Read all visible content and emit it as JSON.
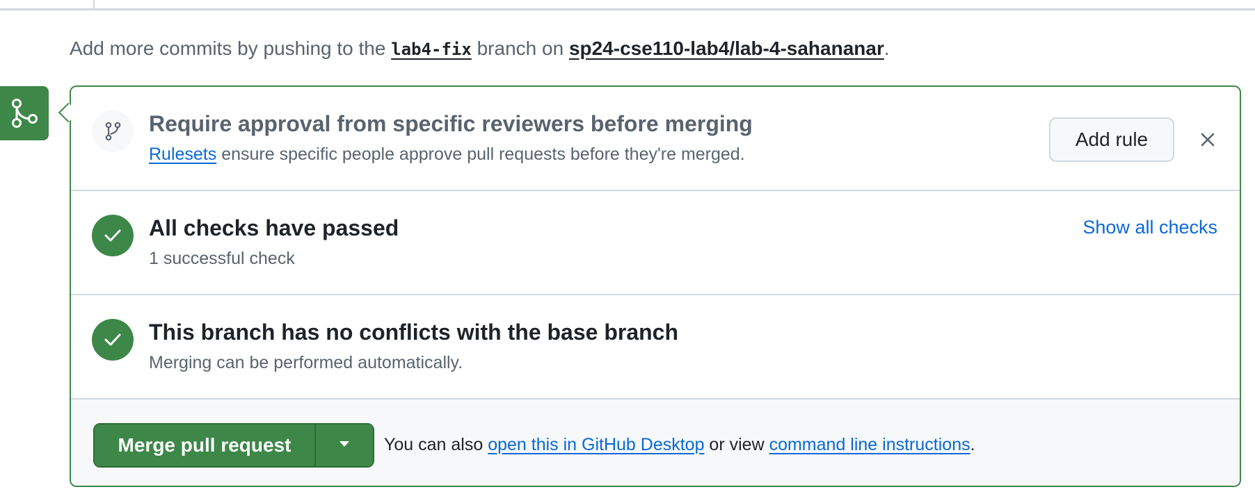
{
  "info": {
    "prefix": "Add more commits by pushing to the",
    "branch": "lab4-fix",
    "middle": "branch on",
    "repo": "sp24-cse110-lab4/lab-4-sahananar",
    "suffix": "."
  },
  "icons": {
    "merge_badge": "git-merge-icon",
    "rule": "git-branch-icon",
    "check": "check-icon",
    "close": "x-icon",
    "dropdown": "triangle-down-icon"
  },
  "colors": {
    "accent_green": "#3d8748",
    "link_blue": "#0969da",
    "muted_text": "#59636e",
    "footer_bg": "#f6f8fa"
  },
  "ruleset": {
    "title": "Require approval from specific reviewers before merging",
    "link": "Rulesets",
    "description": " ensure specific people approve pull requests before they're merged.",
    "button": "Add rule"
  },
  "checks": {
    "title": "All checks have passed",
    "subtitle": "1 successful check",
    "link": "Show all checks"
  },
  "conflicts": {
    "title": "This branch has no conflicts with the base branch",
    "subtitle": "Merging can be performed automatically."
  },
  "merge": {
    "button": "Merge pull request",
    "also_prefix": "You can also ",
    "desktop_link": "open this in GitHub Desktop",
    "or_view": " or view ",
    "cli_link": "command line instructions",
    "suffix": "."
  }
}
